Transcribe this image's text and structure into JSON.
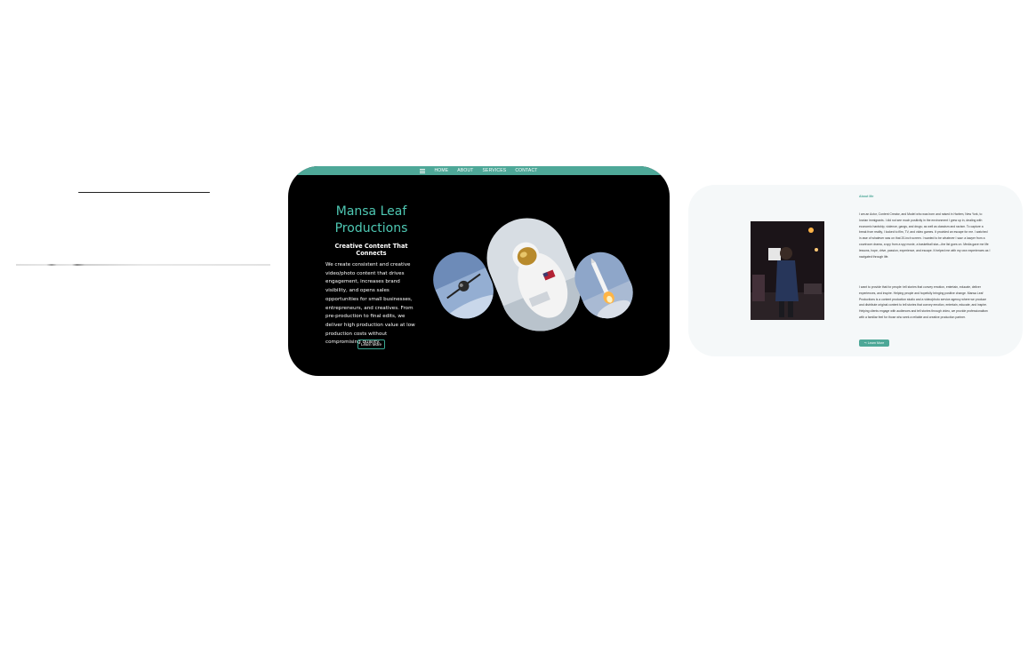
{
  "nav": {
    "menu_icon": "menu-icon",
    "items": [
      "HOME",
      "ABOUT",
      "SERVICES",
      "CONTACT"
    ]
  },
  "hero": {
    "title": "Mansa Leaf Productions",
    "subtitle": "Creative Content That Connects",
    "body": "We create consistent and creative video/photo content that drives engagement, increases brand visibility, and opens sales opportunities for small businesses, entrepreneurs, and creatives. From pre-production to final edits, we deliver high production value at low production costs without compromising quality.",
    "button_label": "Learn More",
    "images": [
      "satellite-image",
      "astronaut-image",
      "rocket-launch-image"
    ]
  },
  "about": {
    "label": "About Me",
    "paragraph1": "I am an Actor, Content Creator, and Model who was born and raised in Harlem, New York, to Ivorian immigrants. I did not see much positivity in the environment I grew up in, dealing with economic hardship, violence, gangs, and drugs; as well as classism and racism. To capture a break from reality, I looked to film, TV, and video games. It provided an escape for me. I watched in awe of whatever was on that 20-inch screen. I wanted to be whatever I saw: a lawyer from a courtroom drama, a spy from a spy movie, a basketball star—the list goes on. Media gave me life lessons, hope, drive, passion, experience, and escape. It helped me with my own experiences as I navigated through life.",
    "paragraph2": "I want to provide that for people: tell stories that convey emotion, entertain, educate, deliver experiences, and inspire. Helping people and hopefully bringing positive change. Mansa Leaf Productions is a content production studio and a video/photo service agency where we produce and distribute original content to tell stories that convey emotion, entertain, educate, and inspire. Helping clients engage with audiences and tell stories through video, we provide professionalism with a familiar feel for those who seek a reliable and creative production partner.",
    "button_label": "Learn More",
    "button_icon": "arrow-icon",
    "photo": "portrait-photo"
  },
  "colors": {
    "accent": "#4ea898",
    "hero_title": "#4ec8b3",
    "hero_bg": "#000000",
    "about_bg": "#f5f8f9"
  }
}
